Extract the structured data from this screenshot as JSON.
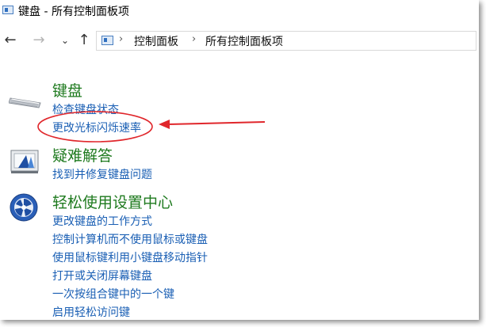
{
  "window": {
    "title": "键盘 - 所有控制面板项",
    "icon": "control-panel-icon"
  },
  "nav": {
    "back_icon": "back-arrow-icon",
    "forward_icon": "forward-arrow-icon",
    "recent_icon": "chevron-down-icon",
    "up_icon": "up-arrow-icon",
    "breadcrumb": [
      "控制面板",
      "所有控制面板项"
    ]
  },
  "sections": [
    {
      "id": "keyboard",
      "icon": "keyboard-icon",
      "title": "键盘",
      "links": [
        "检查键盘状态",
        "更改光标闪烁速率"
      ]
    },
    {
      "id": "troubleshoot",
      "icon": "troubleshoot-icon",
      "title": "疑难解答",
      "links": [
        "找到并修复键盘问题"
      ]
    },
    {
      "id": "ease-of-access",
      "icon": "ease-of-access-icon",
      "title": "轻松使用设置中心",
      "links": [
        "更改键盘的工作方式",
        "控制计算机而不使用鼠标或键盘",
        "使用鼠标键利用小键盘移动指针",
        "打开或关闭屏幕键盘",
        "一次按组合键中的一个键",
        "启用轻松访问键"
      ]
    }
  ],
  "annotation": {
    "highlighted_link": "更改光标闪烁速率",
    "color": "#e0262b"
  },
  "colors": {
    "section_title": "#1e7a1e",
    "link": "#1a5fb4"
  }
}
